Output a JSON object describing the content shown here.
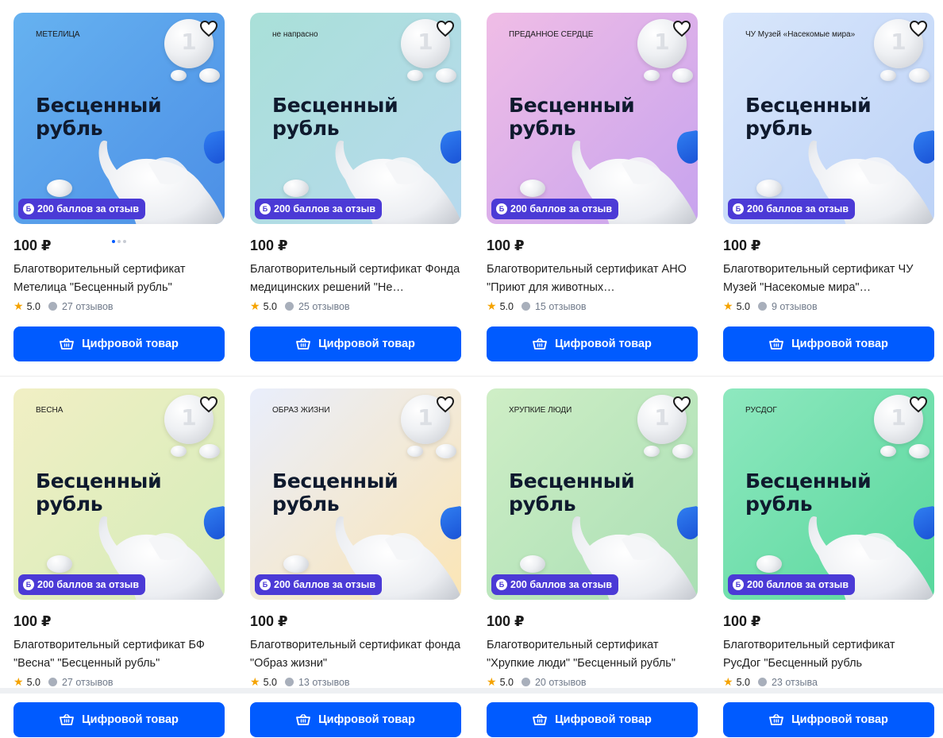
{
  "accent_color": "#005bff",
  "badge_color": "#4b3ad6",
  "badge_icon_letter": "Б",
  "products": [
    {
      "org_logo_text": "МЕТЕЛИЦА",
      "image_title": "Бесценный рубль",
      "image_bg": "linear-gradient(135deg,#66b2f0 0%,#4c8fe6 100%)",
      "badge": "200 баллов за отзыв",
      "price": "100 ₽",
      "name": "Благотворительный сертификат Метелица \"Бесценный рубль\"",
      "rating": "5.0",
      "reviews": "27 отзывов",
      "button": "Цифровой товар"
    },
    {
      "org_logo_text": "не напрасно",
      "image_title": "Бесценный рубль",
      "image_bg": "linear-gradient(135deg,#a9e0d8 0%,#b7d9ee 100%)",
      "badge": "200 баллов за отзыв",
      "price": "100 ₽",
      "name": "Благотворительный сертификат Фонда медицинских решений \"Не…",
      "rating": "5.0",
      "reviews": "25 отзывов",
      "button": "Цифровой товар"
    },
    {
      "org_logo_text": "ПРЕДАННОЕ СЕРДЦЕ",
      "image_title": "Бесценный рубль",
      "image_bg": "linear-gradient(135deg,#f0bde6 0%,#c7a3ee 100%)",
      "badge": "200 баллов за отзыв",
      "price": "100 ₽",
      "name": "Благотворительный сертификат АНО \"Приют для животных…",
      "rating": "5.0",
      "reviews": "15 отзывов",
      "button": "Цифровой товар"
    },
    {
      "org_logo_text": "ЧУ Музей «Насекомые мира»",
      "image_title": "Бесценный рубль",
      "image_bg": "linear-gradient(135deg,#d8e6fb 0%,#bcd2f7 100%)",
      "badge": "200 баллов за отзыв",
      "price": "100 ₽",
      "name": "Благотворительный сертификат ЧУ Музей \"Насекомые мира\"…",
      "rating": "5.0",
      "reviews": "9 отзывов",
      "button": "Цифровой товар"
    },
    {
      "org_logo_text": "ВЕСНА",
      "image_title": "Бесценный рубль",
      "image_bg": "linear-gradient(135deg,#f1efc4 0%,#d4ecb9 100%)",
      "badge": "200 баллов за отзыв",
      "price": "100 ₽",
      "name": "Благотворительный сертификат БФ \"Весна\" \"Бесценный рубль\"",
      "rating": "5.0",
      "reviews": "27 отзывов",
      "button": "Цифровой товар"
    },
    {
      "org_logo_text": "ОБРАЗ ЖИЗНИ",
      "image_title": "Бесценный рубль",
      "image_bg": "linear-gradient(135deg,#e9eefc 0%,#fbe5b5 100%)",
      "badge": "200 баллов за отзыв",
      "price": "100 ₽",
      "name": "Благотворительный сертификат фонда \"Образ жизни\"",
      "rating": "5.0",
      "reviews": "13 отзывов",
      "button": "Цифровой товар"
    },
    {
      "org_logo_text": "ХРУПКИЕ ЛЮДИ",
      "image_title": "Бесценный рубль",
      "image_bg": "linear-gradient(135deg,#cfeec6 0%,#a9dfb4 100%)",
      "badge": "200 баллов за отзыв",
      "price": "100 ₽",
      "name": "Благотворительный сертификат \"Хрупкие люди\" \"Бесценный рубль\"",
      "rating": "5.0",
      "reviews": "20 отзывов",
      "button": "Цифровой товар"
    },
    {
      "org_logo_text": "РУСДОГ",
      "image_title": "Бесценный рубль",
      "image_bg": "linear-gradient(135deg,#8ee8bf 0%,#57d79c 100%)",
      "badge": "200 баллов за отзыв",
      "price": "100 ₽",
      "name": "Благотворительный сертификат РусДог \"Бесценный рубль",
      "rating": "5.0",
      "reviews": "23 отзыва",
      "button": "Цифровой товар"
    }
  ]
}
